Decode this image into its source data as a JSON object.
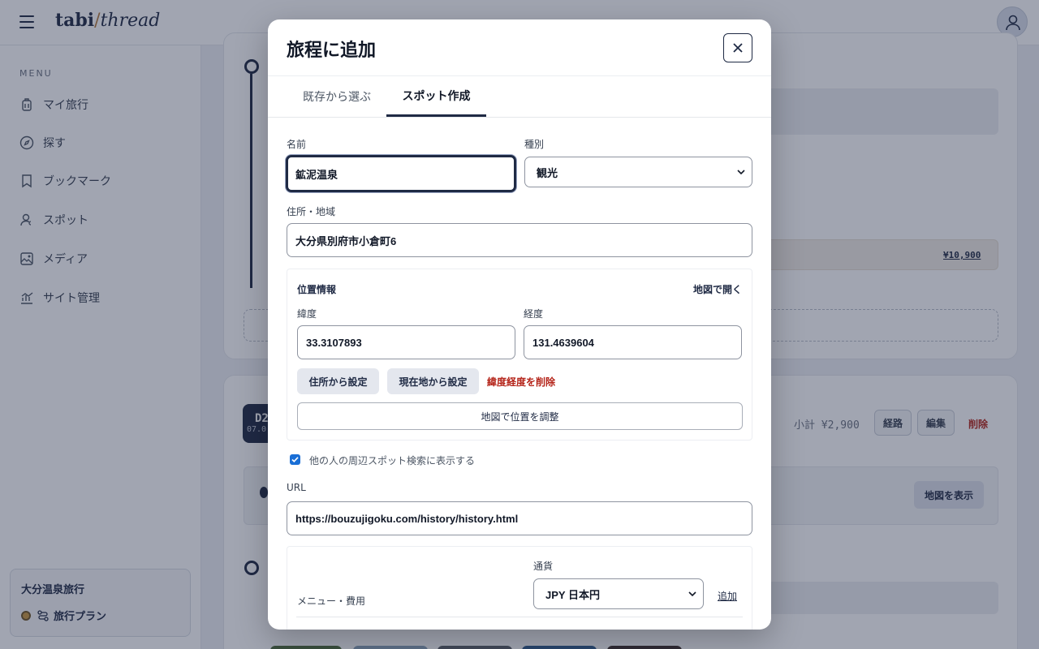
{
  "app": {
    "logo_main": "tabi",
    "logo_slash": "/",
    "logo_thread": "thread"
  },
  "sidebar": {
    "menu_heading": "MENU",
    "items": [
      {
        "label": "マイ旅行",
        "icon": "suitcase-icon"
      },
      {
        "label": "探す",
        "icon": "compass-icon"
      },
      {
        "label": "ブックマーク",
        "icon": "bookmark-icon"
      },
      {
        "label": "スポット",
        "icon": "user-pin-icon"
      },
      {
        "label": "メディア",
        "icon": "image-icon"
      },
      {
        "label": "サイト管理",
        "icon": "chart-icon"
      }
    ],
    "trip": {
      "title": "大分温泉旅行",
      "plan_label": "旅行プラン"
    }
  },
  "background": {
    "price_tag": "¥10,900",
    "day_label": "D2",
    "day_date": "07.0",
    "subtotal": "小計 ¥2,900",
    "route_button": "経路",
    "edit_button": "編集",
    "delete_button": "削除",
    "map_button": "地図を表示"
  },
  "modal": {
    "title": "旅程に追加",
    "tabs": [
      {
        "label": "既存から選ぶ",
        "active": false
      },
      {
        "label": "スポット作成",
        "active": true
      }
    ],
    "form": {
      "name_label": "名前",
      "name_value": "鉱泥温泉",
      "type_label": "種別",
      "type_value": "観光",
      "address_label": "住所・地域",
      "address_value": "大分県別府市小倉町6",
      "location": {
        "heading": "位置情報",
        "open_map": "地図で開く",
        "lat_label": "緯度",
        "lat_value": "33.3107893",
        "lng_label": "経度",
        "lng_value": "131.4639604",
        "from_address_button": "住所から設定",
        "from_current_button": "現在地から設定",
        "clear_link": "緯度経度を削除",
        "adjust_button": "地図で位置を調整"
      },
      "share_checkbox_label": "他の人の周辺スポット検索に表示する",
      "share_checked": true,
      "url_label": "URL",
      "url_value": "https://bouzujigoku.com/history/history.html",
      "cost": {
        "heading": "メニュー・費用",
        "currency_label": "通貨",
        "currency_value": "JPY 日本円",
        "add_link": "追加"
      }
    }
  },
  "colors": {
    "navy": "#1f2a44",
    "danger": "#b42318",
    "accent_gold": "#c8963e",
    "checkbox": "#1a6fd6"
  }
}
